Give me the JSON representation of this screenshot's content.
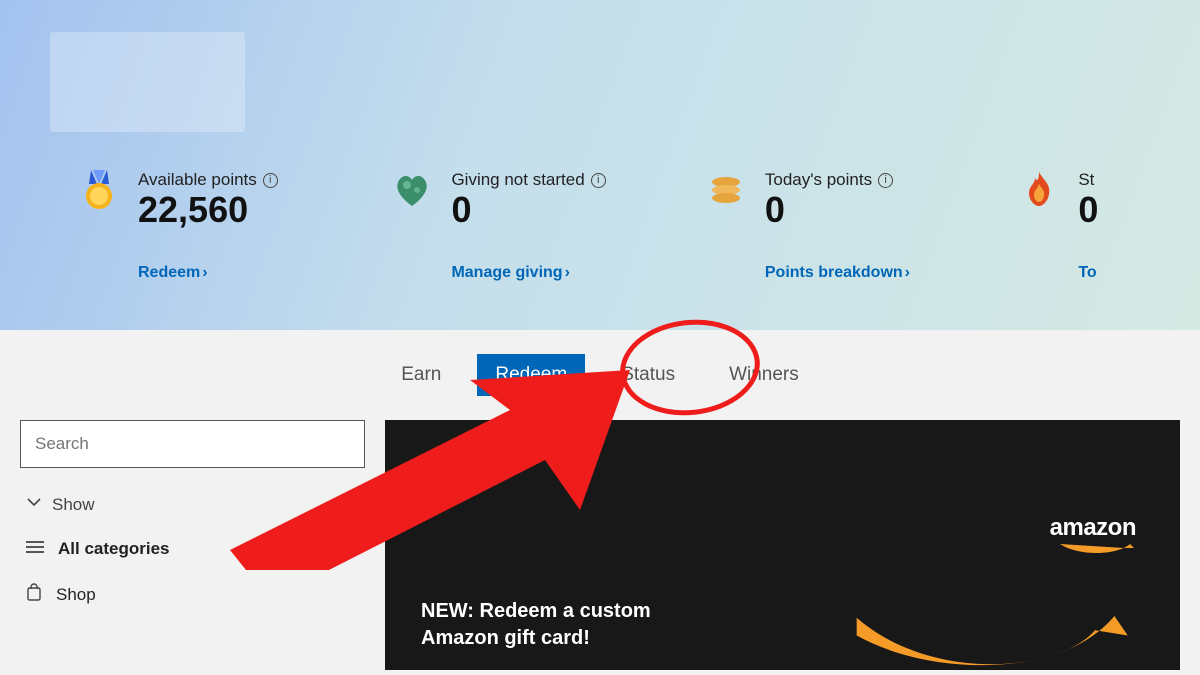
{
  "hero": {
    "stats": [
      {
        "label": "Available points",
        "value": "22,560",
        "link": "Redeem"
      },
      {
        "label": "Giving not started",
        "value": "0",
        "link": "Manage giving"
      },
      {
        "label": "Today's points",
        "value": "0",
        "link": "Points breakdown"
      },
      {
        "label": "St",
        "value": "0",
        "link": "To"
      }
    ]
  },
  "tabs": {
    "items": [
      "Earn",
      "Redeem",
      "Status",
      "Winners"
    ],
    "active_index": 1
  },
  "sidebar": {
    "search_placeholder": "Search",
    "show_label": "Show",
    "categories": [
      {
        "label": "All categories",
        "bold": true
      },
      {
        "label": "Shop",
        "bold": false
      }
    ]
  },
  "promo": {
    "title": "NEW: Redeem a custom Amazon gift card!",
    "brand": "amazon"
  },
  "colors": {
    "accent": "#0067b8",
    "annotation": "#ef1c1c",
    "amazon_orange": "#f59b28"
  }
}
